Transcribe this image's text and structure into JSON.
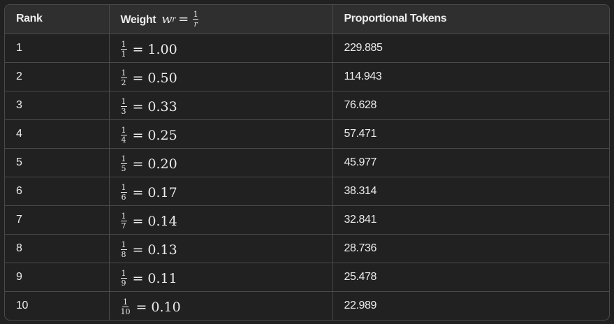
{
  "table": {
    "headers": {
      "rank": "Rank",
      "weight_label": "Weight",
      "weight_symbol": "w",
      "weight_subscript": "r",
      "weight_formula_num": "1",
      "weight_formula_den": "r",
      "tokens": "Proportional Tokens"
    },
    "rows": [
      {
        "rank": "1",
        "num": "1",
        "den": "1",
        "weight": "1.00",
        "tokens": "229.885"
      },
      {
        "rank": "2",
        "num": "1",
        "den": "2",
        "weight": "0.50",
        "tokens": "114.943"
      },
      {
        "rank": "3",
        "num": "1",
        "den": "3",
        "weight": "0.33",
        "tokens": "76.628"
      },
      {
        "rank": "4",
        "num": "1",
        "den": "4",
        "weight": "0.25",
        "tokens": "57.471"
      },
      {
        "rank": "5",
        "num": "1",
        "den": "5",
        "weight": "0.20",
        "tokens": "45.977"
      },
      {
        "rank": "6",
        "num": "1",
        "den": "6",
        "weight": "0.17",
        "tokens": "38.314"
      },
      {
        "rank": "7",
        "num": "1",
        "den": "7",
        "weight": "0.14",
        "tokens": "32.841"
      },
      {
        "rank": "8",
        "num": "1",
        "den": "8",
        "weight": "0.13",
        "tokens": "28.736"
      },
      {
        "rank": "9",
        "num": "1",
        "den": "9",
        "weight": "0.11",
        "tokens": "25.478"
      },
      {
        "rank": "10",
        "num": "1",
        "den": "10",
        "weight": "0.10",
        "tokens": "22.989"
      }
    ]
  }
}
